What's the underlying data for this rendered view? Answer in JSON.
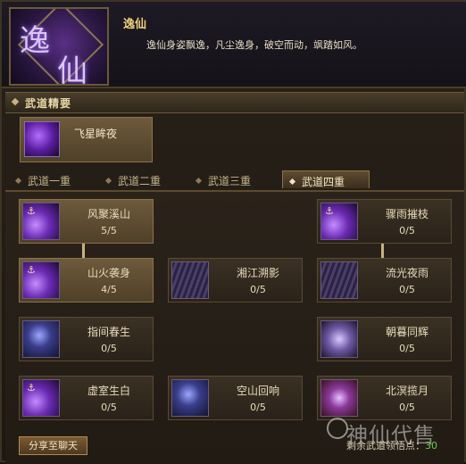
{
  "header": {
    "emblem_chars": [
      "逸",
      "仙"
    ],
    "title": "逸仙",
    "description": "逸仙身姿飘逸，凡尘逸身，破空而动，飒踏如风。"
  },
  "section": {
    "title": "武道精要",
    "featured_skill": "飞星眸夜"
  },
  "tabs": [
    {
      "label": "武道一重",
      "active": false
    },
    {
      "label": "武道二重",
      "active": false
    },
    {
      "label": "武道三重",
      "active": false
    },
    {
      "label": "武道四重",
      "active": true
    }
  ],
  "skills": {
    "r1c1": {
      "name": "风聚溪山",
      "count": "5/5",
      "icon": "purple-slash-icon"
    },
    "r1c3": {
      "name": "骤雨摧枝",
      "count": "0/5",
      "icon": "purple-streak-icon"
    },
    "r2c1": {
      "name": "山火袭身",
      "count": "4/5",
      "icon": "purple-slash-icon"
    },
    "r2c2": {
      "name": "湘江溯影",
      "count": "0/5",
      "icon": "stripe-wave-icon"
    },
    "r2c3": {
      "name": "流光夜雨",
      "count": "0/5",
      "icon": "stripe-wave-icon"
    },
    "r3c1": {
      "name": "指间春生",
      "count": "0/5",
      "icon": "moon-swirl-icon"
    },
    "r3c3": {
      "name": "朝暮同辉",
      "count": "0/5",
      "icon": "dawn-glow-icon"
    },
    "r4c1": {
      "name": "虚室生白",
      "count": "0/5",
      "icon": "purple-streak-icon"
    },
    "r4c2": {
      "name": "空山回响",
      "count": "0/5",
      "icon": "moon-swirl-icon"
    },
    "r4c3": {
      "name": "北溟揽月",
      "count": "0/5",
      "icon": "red-vortex-icon"
    }
  },
  "bottom": {
    "share_label": "分享至聊天",
    "remaining_label": "剩余武道领悟点：",
    "remaining_value": "30",
    "watermark": "神仙代售"
  }
}
